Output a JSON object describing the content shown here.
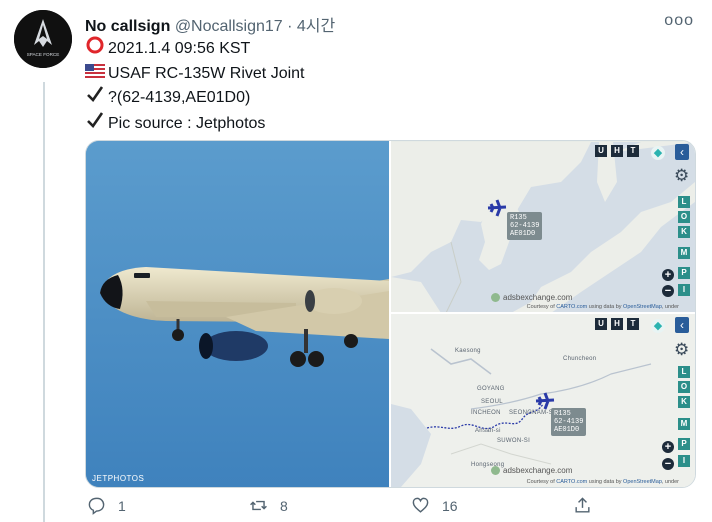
{
  "tweet": {
    "author_name": "No callsign",
    "handle": "@Nocallsign17",
    "separator": "·",
    "time": "4시간",
    "more": "ooo",
    "avatar_text": "SPACE FORCE",
    "lines": [
      {
        "icon": "red-circle",
        "text": "2021.1.4 09:56 KST"
      },
      {
        "icon": "us-flag",
        "text": "USAF RC-135W Rivet Joint"
      },
      {
        "icon": "check-mark",
        "text": "?(62-4139,AE01D0)"
      },
      {
        "icon": "check-mark",
        "text": "Pic source : Jetphotos"
      }
    ]
  },
  "media": {
    "photo_credit": "JETPHOTOS",
    "map1": {
      "buttons": [
        "U",
        "H",
        "T"
      ],
      "side_keys": [
        "L",
        "O",
        "K",
        "M",
        "P",
        "I"
      ],
      "tag": [
        "R135",
        "62-4139",
        "AE01D0"
      ],
      "adsb": "adsbexchange.com",
      "attribution_prefix": "Courtesy of",
      "attribution_carto": "CARTO.com",
      "attribution_mid": "using data by",
      "attribution_osm": "OpenStreetMap",
      "attribution_suffix": ", under"
    },
    "map2": {
      "buttons": [
        "U",
        "H",
        "T"
      ],
      "side_keys": [
        "L",
        "O",
        "K",
        "M",
        "P",
        "I"
      ],
      "tag": [
        "R135",
        "62-4139",
        "AE01D0"
      ],
      "adsb": "adsbexchange.com",
      "attribution_prefix": "Courtesy of",
      "attribution_carto": "CARTO.com",
      "attribution_mid": "using data by",
      "attribution_osm": "OpenStreetMap",
      "attribution_suffix": ", under",
      "cities": [
        "Kaesong",
        "Chuncheon",
        "GOYANG",
        "SEOUL",
        "INCHEON",
        "SEONGNAM-SI",
        "Ansan-si",
        "SUWON-SI",
        "Hongseong"
      ]
    }
  },
  "actions": {
    "reply_count": "1",
    "retweet_count": "8",
    "like_count": "16"
  },
  "colors": {
    "accent": "#1d9bf0",
    "sky": "#4f90c3",
    "track": "#2a3aa8"
  }
}
